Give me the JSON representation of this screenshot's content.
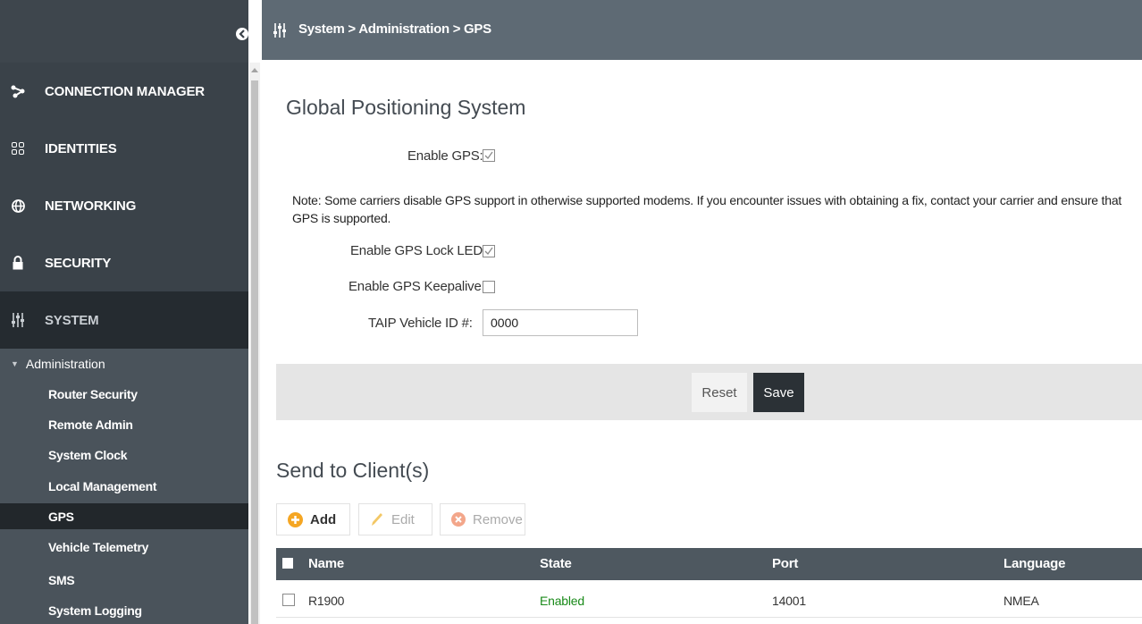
{
  "breadcrumb": "System > Administration > GPS",
  "nav": [
    {
      "label": "CONNECTION MANAGER",
      "icon": "connection-icon"
    },
    {
      "label": "IDENTITIES",
      "icon": "identities-grid-icon"
    },
    {
      "label": "NETWORKING",
      "icon": "globe-icon"
    },
    {
      "label": "SECURITY",
      "icon": "lock-icon"
    },
    {
      "label": "SYSTEM",
      "icon": "sliders-icon",
      "active": true
    }
  ],
  "subnav": {
    "header": "Administration",
    "items": [
      "Router Security",
      "Remote Admin",
      "System Clock",
      "Local Management",
      "GPS",
      "Vehicle Telemetry",
      "SMS",
      "System Logging"
    ],
    "active": "GPS"
  },
  "gps": {
    "title": "Global Positioning System",
    "enable_gps_label": "Enable GPS:",
    "enable_gps_checked": true,
    "note": "Note: Some carriers disable GPS support in otherwise supported modems. If you encounter issues with obtaining a fix, contact your carrier and ensure that GPS is supported.",
    "lock_led_label": "Enable GPS Lock LED:",
    "lock_led_checked": true,
    "keepalive_label": "Enable GPS Keepalive:",
    "keepalive_checked": false,
    "taip_label": "TAIP Vehicle ID #:",
    "taip_value": "0000"
  },
  "actions": {
    "reset": "Reset",
    "save": "Save"
  },
  "clients": {
    "title": "Send to Client(s)",
    "toolbar": {
      "add": "Add",
      "edit": "Edit",
      "remove": "Remove"
    },
    "columns": [
      "Name",
      "State",
      "Port",
      "Language"
    ],
    "rows": [
      {
        "name": "R1900",
        "state": "Enabled",
        "port": "14001",
        "language": "NMEA"
      }
    ]
  },
  "colors": {
    "accent_add": "#f5a623",
    "enabled_text": "#1a8a1a",
    "remove_icon": "#f3a68a"
  }
}
